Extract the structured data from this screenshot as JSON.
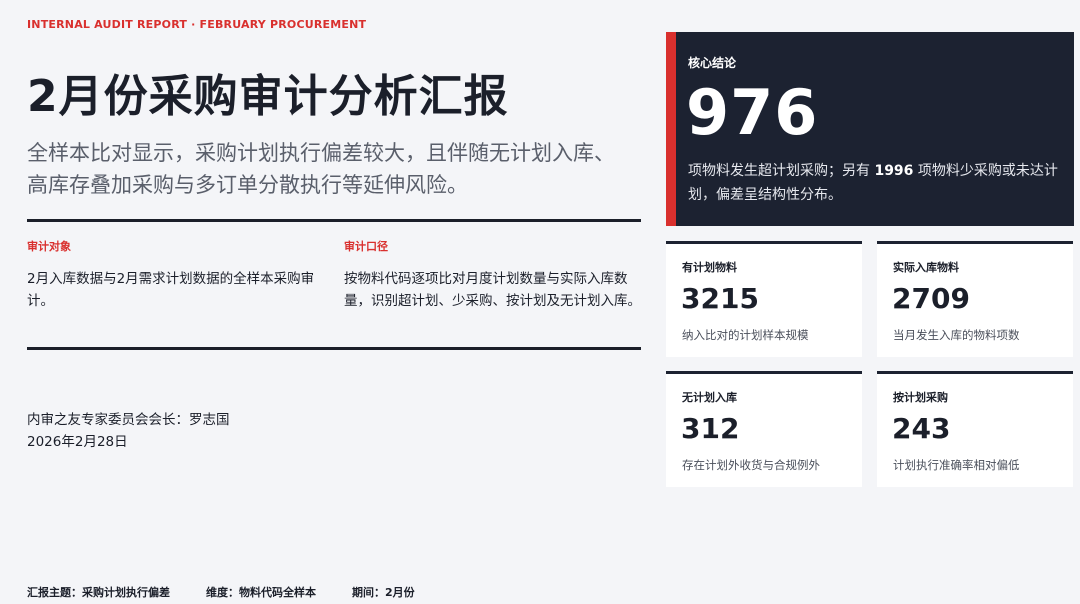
{
  "header": {
    "kicker": "INTERNAL AUDIT REPORT · FEBRUARY PROCUREMENT",
    "title": "2月份采购审计分析汇报",
    "subtitle": "全样本比对显示，采购计划执行偏差较大，且伴随无计划入库、高库存叠加采购与多订单分散执行等延伸风险。"
  },
  "scope": {
    "object_label": "审计对象",
    "object_text": "2月入库数据与2月需求计划数据的全样本采购审计。",
    "method_label": "审计口径",
    "method_text": "按物料代码逐项比对月度计划数量与实际入库数量，识别超计划、少采购、按计划及无计划入库。"
  },
  "signature": {
    "author": "内审之友专家委员会会长：罗志国",
    "date": "2026年2月28日"
  },
  "footer": {
    "topic": "汇报主题：采购计划执行偏差",
    "dimension": "维度：物料代码全样本",
    "period": "期间：2月份"
  },
  "hero": {
    "label": "核心结论",
    "value": "976",
    "text_a": "项物料发生超计划采购；另有 ",
    "text_b": "1996",
    "text_c": " 项物料少采购或未达计划，偏差呈结构性分布。"
  },
  "cards": [
    {
      "label": "有计划物料",
      "value": "3215",
      "desc": "纳入比对的计划样本规模"
    },
    {
      "label": "实际入库物料",
      "value": "2709",
      "desc": "当月发生入库的物料项数"
    },
    {
      "label": "无计划入库",
      "value": "312",
      "desc": "存在计划外收货与合规例外"
    },
    {
      "label": "按计划采购",
      "value": "243",
      "desc": "计划执行准确率相对偏低"
    }
  ],
  "colors": {
    "accent": "#d9302e",
    "dark": "#1c2231",
    "background": "#f4f5f8"
  }
}
